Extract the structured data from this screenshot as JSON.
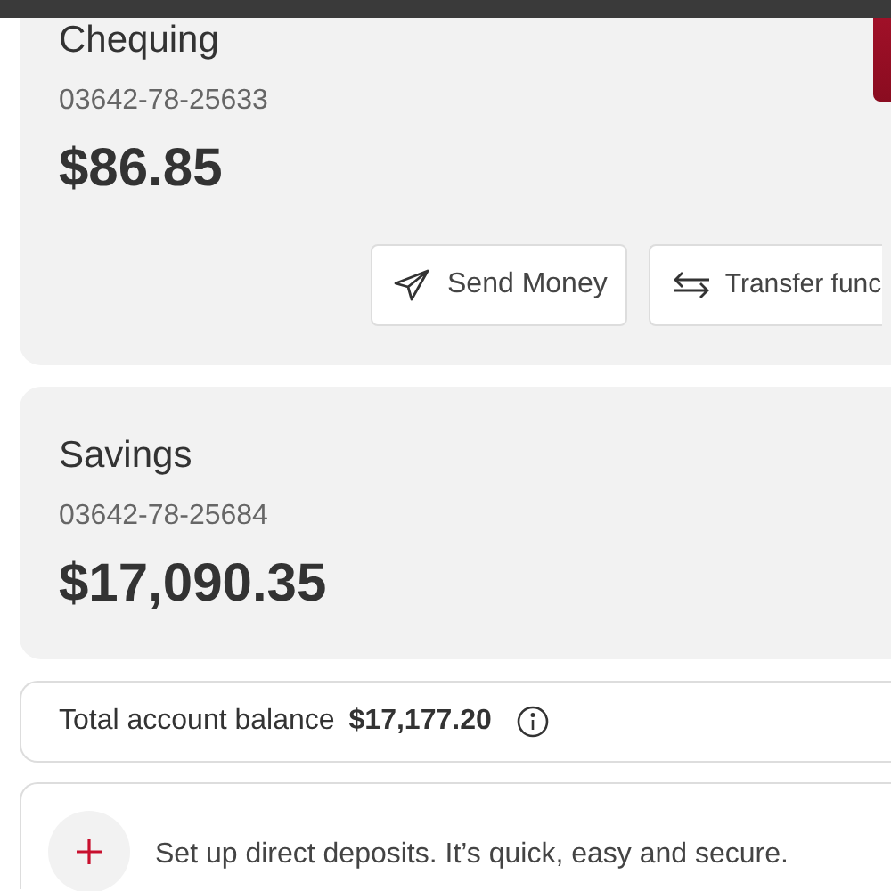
{
  "accounts": [
    {
      "name": "Chequing",
      "number": "03642-78-25633",
      "balance": "$86.85",
      "actions": [
        {
          "label": "Send Money",
          "kind": "send"
        },
        {
          "label": "Transfer func",
          "kind": "transfer"
        }
      ]
    },
    {
      "name": "Savings",
      "number": "03642-78-25684",
      "balance": "$17,090.35"
    }
  ],
  "total": {
    "label": "Total account balance",
    "amount": "$17,177.20"
  },
  "promo": {
    "text": "Set up direct deposits. It’s quick, easy and secure."
  }
}
